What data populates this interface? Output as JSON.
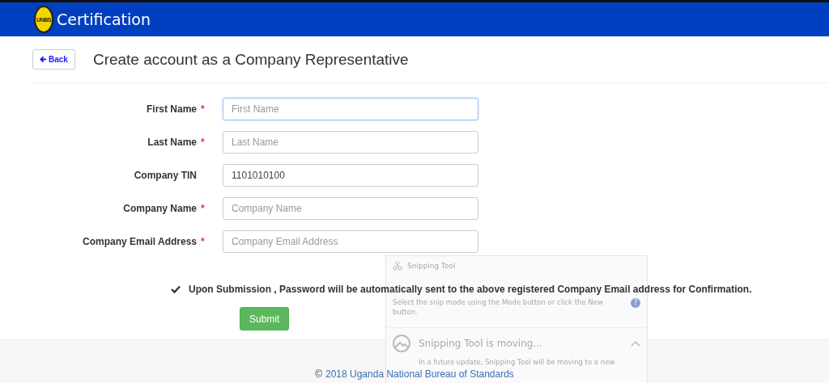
{
  "header": {
    "title": "Certification",
    "logo_text": "UNBS"
  },
  "back_button": "Back",
  "page_title": "Create account as a Company Representative",
  "fields": [
    {
      "label": "First Name",
      "required": true,
      "placeholder": "First Name",
      "focused": true
    },
    {
      "label": "Last Name",
      "required": true,
      "placeholder": "Last Name",
      "focused": false
    },
    {
      "label": "Company TIN",
      "required": false,
      "value": "1101010100",
      "focused": false
    },
    {
      "label": "Company Name",
      "required": true,
      "placeholder": "Company Name",
      "focused": false
    },
    {
      "label": "Company Email Address",
      "required": true,
      "placeholder": "Company Email Address",
      "focused": false
    }
  ],
  "required_mark": "*",
  "notice": "Upon Submission , Password will be automatically sent to the above registered Company Email address for Confirmation.",
  "submit_button": "Submit",
  "footer": {
    "symbol": "©",
    "link": "2018 Uganda National Bureau of Standards"
  },
  "overlay_window": {
    "title": "Snipping Tool",
    "hint": "Select the snip mode using the Mode button or click the New button.",
    "help": "?",
    "banner_title": "Snipping Tool is moving...",
    "banner_text": "In a future update, Snipping Tool will be moving to a new"
  }
}
